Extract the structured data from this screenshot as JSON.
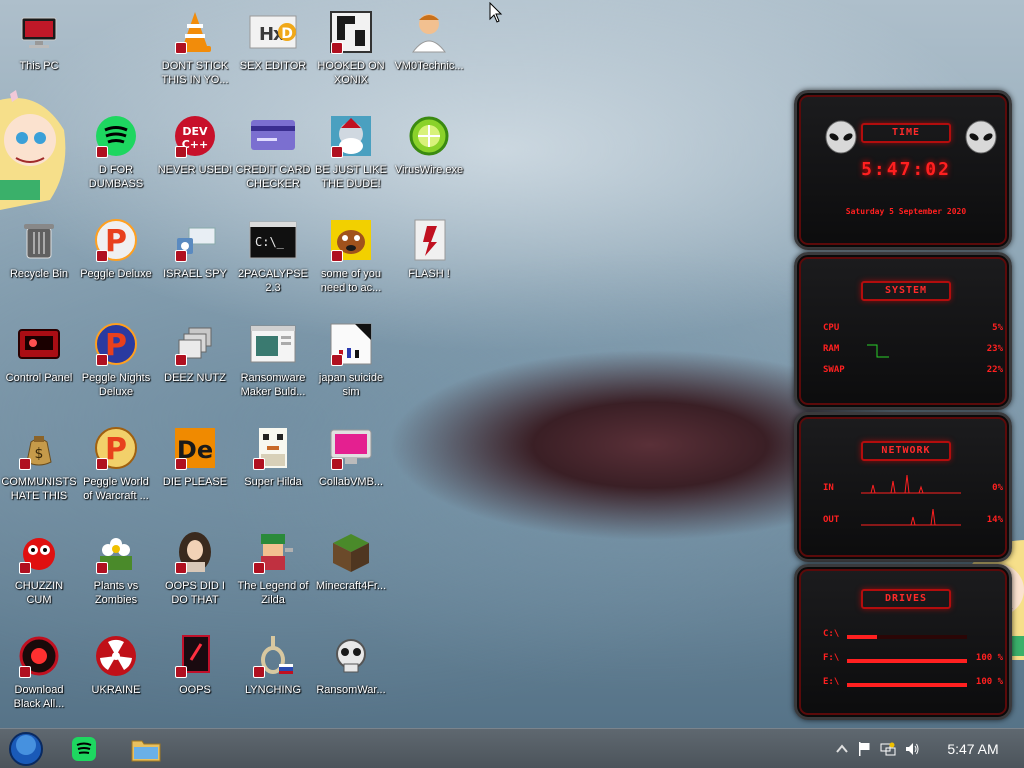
{
  "desktop": {
    "icons": [
      {
        "label": "This PC"
      },
      {
        "label": "DONT STICK THIS IN YO..."
      },
      {
        "label": "SEX EDITOR"
      },
      {
        "label": "HOOKED ON XONIX"
      },
      {
        "label": "VM0Technic..."
      },
      {
        "label": "D FOR DUMBASS"
      },
      {
        "label": "NEVER USED!"
      },
      {
        "label": "CREDIT CARD CHECKER"
      },
      {
        "label": "BE JUST LIKE THE DUDE!"
      },
      {
        "label": "VirusWire.exe"
      },
      {
        "label": "Recycle Bin"
      },
      {
        "label": "Peggle Deluxe"
      },
      {
        "label": "ISRAEL SPY"
      },
      {
        "label": "2PACALYPSE 2.3"
      },
      {
        "label": "some of you need to ac..."
      },
      {
        "label": "FLASH !"
      },
      {
        "label": "Control Panel"
      },
      {
        "label": "Peggle Nights Deluxe"
      },
      {
        "label": "DEEZ NUTZ"
      },
      {
        "label": "Ransomware Maker Buld..."
      },
      {
        "label": "japan suicide sim"
      },
      {
        "label": "COMMUNISTS HATE THIS G..."
      },
      {
        "label": "Peggle World of Warcraft ..."
      },
      {
        "label": "DIE PLEASE"
      },
      {
        "label": "Super Hilda"
      },
      {
        "label": "CollabVMB..."
      },
      {
        "label": "CHUZZIN CUM"
      },
      {
        "label": "Plants vs Zombies"
      },
      {
        "label": "OOPS DID I DO THAT"
      },
      {
        "label": "The Legend of Zilda"
      },
      {
        "label": "Minecraft4Fr..."
      },
      {
        "label": "Download Black All..."
      },
      {
        "label": "UKRAINE"
      },
      {
        "label": "OOPS"
      },
      {
        "label": "LYNCHING"
      },
      {
        "label": "RansomWar..."
      }
    ]
  },
  "widget": {
    "time": {
      "title": "TIME",
      "clock": "5:47:02",
      "date": "Saturday 5 September 2020"
    },
    "system": {
      "title": "SYSTEM",
      "rows": [
        {
          "key": "CPU",
          "value": "5%",
          "level": 0.05
        },
        {
          "key": "RAM",
          "value": "23%",
          "level": 0.23
        },
        {
          "key": "SWAP",
          "value": "22%",
          "level": 0.22
        }
      ]
    },
    "network": {
      "title": "NETWORK",
      "rows": [
        {
          "key": "IN",
          "value": "0%"
        },
        {
          "key": "OUT",
          "value": "14%"
        }
      ]
    },
    "drives": {
      "title": "DRIVES",
      "rows": [
        {
          "key": "C:\\",
          "value": "",
          "level": 0.25
        },
        {
          "key": "F:\\",
          "value": "100 %",
          "level": 1.0
        },
        {
          "key": "E:\\",
          "value": "100 %",
          "level": 1.0
        }
      ]
    }
  },
  "taskbar": {
    "clock": "5:47 AM"
  },
  "colors": {
    "widget_red": "#ff2020",
    "taskbar": "#566068",
    "label_text": "#ffffff"
  }
}
